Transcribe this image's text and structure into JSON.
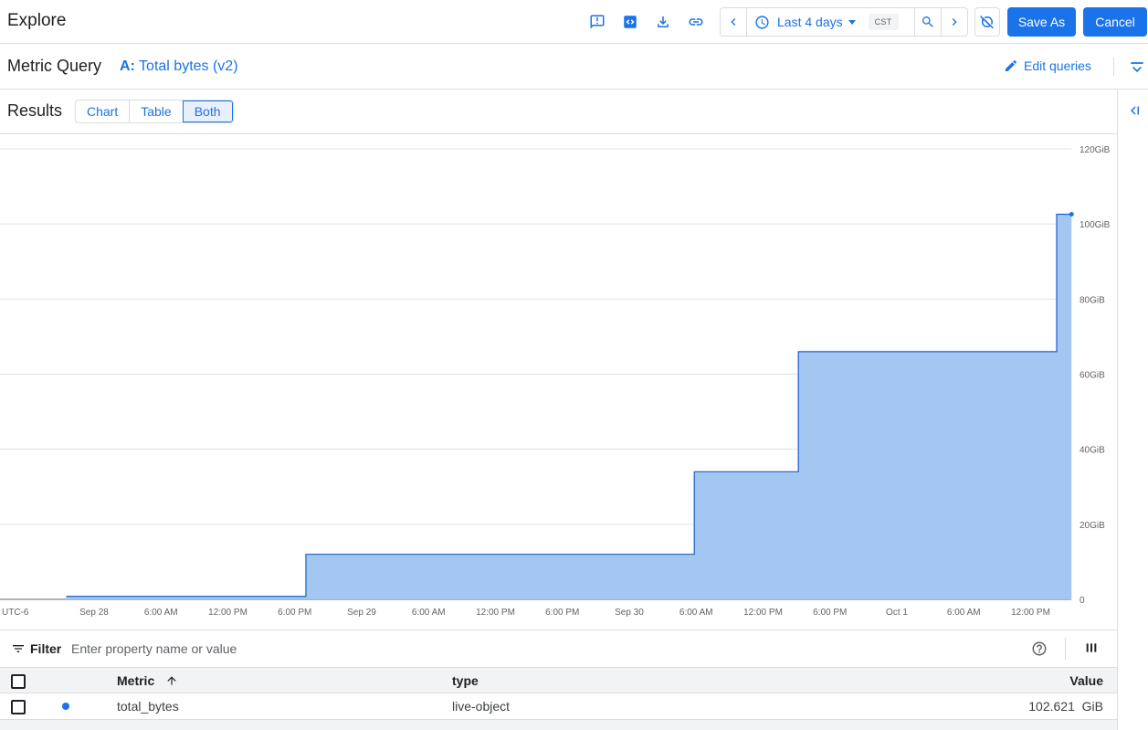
{
  "header": {
    "title": "Explore",
    "time_range_label": "Last 4 days",
    "timezone": "CST",
    "save_as_label": "Save As",
    "cancel_label": "Cancel",
    "icons": [
      "feedback-icon",
      "code-icon",
      "download-icon",
      "link-icon",
      "chevron-left-icon",
      "clock-icon",
      "caret-down-icon",
      "zoom-icon",
      "chevron-right-icon",
      "auto-refresh-off-icon"
    ]
  },
  "query": {
    "label": "Metric Query",
    "prefix": "A:",
    "name": "Total bytes (v2)",
    "edit_label": "Edit queries"
  },
  "results": {
    "label": "Results",
    "views": [
      "Chart",
      "Table",
      "Both"
    ],
    "selected_view": "Both"
  },
  "colors": {
    "accent": "#1a73e8",
    "series_fill": "#a4c7f2",
    "series_line": "#1a5fcc"
  },
  "chart_data": {
    "type": "area",
    "timezone_label": "UTC-6",
    "x_ticks": [
      "Sep 28",
      "6:00 AM",
      "12:00 PM",
      "6:00 PM",
      "Sep 29",
      "6:00 AM",
      "12:00 PM",
      "6:00 PM",
      "Sep 30",
      "6:00 AM",
      "12:00 PM",
      "6:00 PM",
      "Oct 1",
      "6:00 AM",
      "12:00 PM"
    ],
    "y_ticks": [
      "0",
      "20GiB",
      "40GiB",
      "60GiB",
      "80GiB",
      "100GiB",
      "120GiB"
    ],
    "ylim": [
      0,
      120
    ],
    "y_unit": "GiB",
    "grid": true,
    "step": true,
    "series": [
      {
        "name": "total_bytes",
        "points": [
          {
            "x": "Sep 27 9:30 PM",
            "y": 0.8
          },
          {
            "x": "Sep 28 7:00 PM",
            "y": 12.0
          },
          {
            "x": "Sep 30 5:50 AM",
            "y": 34.0
          },
          {
            "x": "Sep 30 3:10 PM",
            "y": 66.0
          },
          {
            "x": "Oct 1 2:20 PM",
            "y": 102.6
          },
          {
            "x": "Oct 1 3:40 PM",
            "y": 102.6
          }
        ]
      }
    ]
  },
  "filter": {
    "label": "Filter",
    "placeholder": "Enter property name or value"
  },
  "table": {
    "columns": [
      "Metric",
      "type",
      "Value"
    ],
    "rows": [
      {
        "metric": "total_bytes",
        "type": "live-object",
        "value": "102.621",
        "unit": "GiB"
      }
    ]
  }
}
